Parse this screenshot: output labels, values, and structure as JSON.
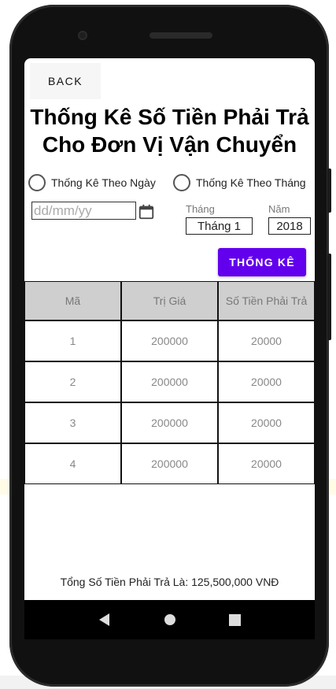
{
  "header": {
    "back_label": "BACK"
  },
  "title": {
    "line1": "Thống Kê Số Tiền Phải Trả",
    "line2": "Cho Đơn Vị Vận Chuyển"
  },
  "filters": {
    "by_day_label": "Thống Kê Theo Ngày",
    "by_month_label": "Thống Kê Theo Tháng",
    "date_placeholder": "dd/mm/yy",
    "month_label": "Tháng",
    "month_value": "Tháng 1",
    "year_label": "Năm",
    "year_value": "2018",
    "submit_label": "THỐNG KÊ"
  },
  "table": {
    "columns": [
      "Mã",
      "Trị Giá",
      "Số Tiền Phải Trả"
    ],
    "rows": [
      [
        "1",
        "200000",
        "20000"
      ],
      [
        "2",
        "200000",
        "20000"
      ],
      [
        "3",
        "200000",
        "20000"
      ],
      [
        "4",
        "200000",
        "20000"
      ]
    ]
  },
  "footer": {
    "total_text": "Tổng Số Tiền Phải Trả Là: 125,500,000 VNĐ"
  },
  "colors": {
    "accent": "#6200ee",
    "header_bg": "#cfcfcf"
  }
}
